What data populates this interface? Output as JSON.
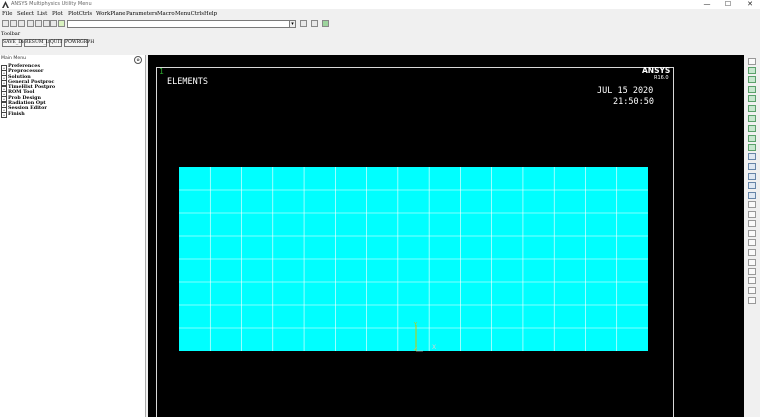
{
  "window": {
    "title": "ANSYS Multiphysics Utility Menu",
    "buttons": [
      "—",
      "☐",
      "✕"
    ]
  },
  "menubar": [
    "File",
    "Select",
    "List",
    "Plot",
    "PlotCtrls",
    "WorkPlane",
    "Parameters",
    "Macro",
    "MenuCtrls",
    "Help"
  ],
  "command": {
    "value": ""
  },
  "toolbar": {
    "label": "Toolbar",
    "buttons": [
      "SAVE_DB",
      "RESUM_DB",
      "QUIT",
      "POWRGRPH"
    ]
  },
  "main_menu": {
    "title": "Main Menu",
    "collapse_symbol": "⊗",
    "items": [
      "Preferences",
      "Preprocessor",
      "Solution",
      "General Postproc",
      "TimeHist Postpro",
      "ROM Tool",
      "Prob Design",
      "Radiation Opt",
      "Session Editor",
      "Finish"
    ]
  },
  "graphics": {
    "window_number": "1",
    "plot_title": "ELEMENTS",
    "logo": "ANSYS",
    "version": "R16.0",
    "date": "JUL 15 2020",
    "time": "21:50:50",
    "triad": {
      "y_label": "Y",
      "x_label": "X"
    },
    "mesh": {
      "fill_color": "#00ffff",
      "line_color": "#ffffff",
      "columns": 15,
      "rows": 8
    }
  },
  "colors": {
    "background": "#000000",
    "accent": "#00ffff",
    "window_number": "#2ea82e"
  }
}
